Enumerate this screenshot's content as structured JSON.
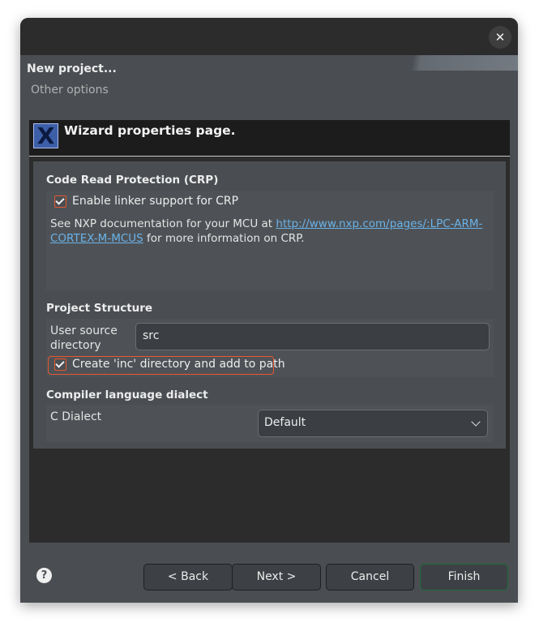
{
  "dialog": {
    "close_glyph": "✕",
    "header_title": "New project...",
    "header_subtitle": "Other options",
    "banner_icon": "X",
    "banner_title": "Wizard properties page."
  },
  "crp": {
    "section_title": "Code Read Protection (CRP)",
    "checkbox_label": "Enable linker support for CRP",
    "checkbox_checked": true,
    "desc_prefix": "See NXP documentation for your MCU at ",
    "desc_link_line1": "http://www.nxp.com/pages/:LPC-ARM-",
    "desc_link_line2": "CORTEX-M-MCUS",
    "desc_suffix": " for more information on CRP."
  },
  "structure": {
    "section_title": "Project Structure",
    "source_dir_label_line1": "User source",
    "source_dir_label_line2": "directory",
    "source_dir_value": "src",
    "inc_checkbox_label": "Create 'inc' directory and add to path",
    "inc_checkbox_checked": true
  },
  "dialect": {
    "section_title": "Compiler language dialect",
    "c_dialect_label": "C Dialect",
    "c_dialect_value": "Default"
  },
  "footer": {
    "help_glyph": "?",
    "back_label": "< Back",
    "next_label": "Next >",
    "cancel_label": "Cancel",
    "finish_label": "Finish"
  },
  "colors": {
    "window_bg": "#4a4e52",
    "content_bg": "#2c2c2c",
    "accent_orange": "#e8572f",
    "link": "#6ab2e8",
    "finish_border": "#1e6b3a"
  },
  "icons": [
    "close-icon",
    "wizard-x-icon",
    "checkbox-checked-icon",
    "chevron-down-icon",
    "help-icon"
  ]
}
